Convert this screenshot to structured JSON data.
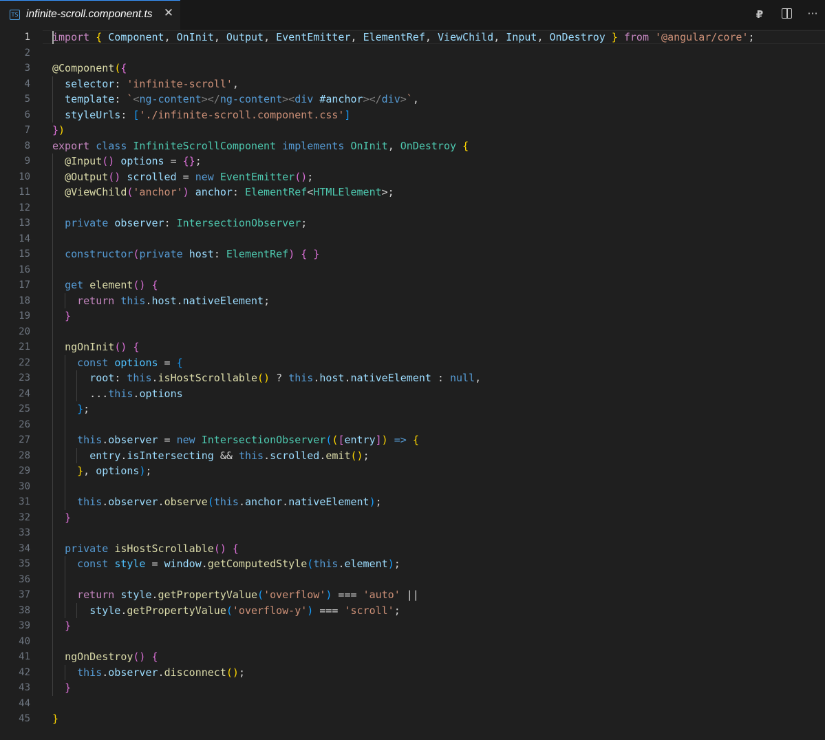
{
  "tab": {
    "icon_text": "TS",
    "filename": "infinite-scroll.component.ts",
    "close_symbol": "✕"
  },
  "toolbar": {
    "preview_icon": "₽",
    "more_icon": "···"
  },
  "editor": {
    "active_line": 1,
    "lines": [
      [
        [
          "k",
          "import"
        ],
        [
          "d",
          " "
        ],
        [
          "y",
          "{"
        ],
        [
          "d",
          " "
        ],
        [
          "v",
          "Component"
        ],
        [
          "d",
          ", "
        ],
        [
          "v",
          "OnInit"
        ],
        [
          "d",
          ", "
        ],
        [
          "v",
          "Output"
        ],
        [
          "d",
          ", "
        ],
        [
          "v",
          "EventEmitter"
        ],
        [
          "d",
          ", "
        ],
        [
          "v",
          "ElementRef"
        ],
        [
          "d",
          ", "
        ],
        [
          "v",
          "ViewChild"
        ],
        [
          "d",
          ", "
        ],
        [
          "v",
          "Input"
        ],
        [
          "d",
          ", "
        ],
        [
          "v",
          "OnDestroy"
        ],
        [
          "d",
          " "
        ],
        [
          "y",
          "}"
        ],
        [
          "d",
          " "
        ],
        [
          "k",
          "from"
        ],
        [
          "d",
          " "
        ],
        [
          "s",
          "'@angular/core'"
        ],
        [
          "d",
          ";"
        ]
      ],
      [],
      [
        [
          "f",
          "@Component"
        ],
        [
          "y",
          "("
        ],
        [
          "p",
          "{"
        ]
      ],
      [
        [
          "d",
          "  "
        ],
        [
          "v",
          "selector"
        ],
        [
          "d",
          ": "
        ],
        [
          "s",
          "'infinite-scroll'"
        ],
        [
          "d",
          ","
        ]
      ],
      [
        [
          "d",
          "  "
        ],
        [
          "v",
          "template"
        ],
        [
          "d",
          ": "
        ],
        [
          "s",
          "`"
        ],
        [
          "tg",
          "<"
        ],
        [
          "b",
          "ng-content"
        ],
        [
          "tg",
          "></"
        ],
        [
          "b",
          "ng-content"
        ],
        [
          "tg",
          "><"
        ],
        [
          "b",
          "div"
        ],
        [
          "d",
          " "
        ],
        [
          "v",
          "#anchor"
        ],
        [
          "tg",
          "></"
        ],
        [
          "b",
          "div"
        ],
        [
          "tg",
          ">"
        ],
        [
          "s",
          "`"
        ],
        [
          "d",
          ","
        ]
      ],
      [
        [
          "d",
          "  "
        ],
        [
          "v",
          "styleUrls"
        ],
        [
          "d",
          ": "
        ],
        [
          "bl",
          "["
        ],
        [
          "s",
          "'./infinite-scroll.component.css'"
        ],
        [
          "bl",
          "]"
        ]
      ],
      [
        [
          "p",
          "}"
        ],
        [
          "y",
          ")"
        ]
      ],
      [
        [
          "k",
          "export"
        ],
        [
          "d",
          " "
        ],
        [
          "b",
          "class"
        ],
        [
          "d",
          " "
        ],
        [
          "t",
          "InfiniteScrollComponent"
        ],
        [
          "d",
          " "
        ],
        [
          "b",
          "implements"
        ],
        [
          "d",
          " "
        ],
        [
          "t",
          "OnInit"
        ],
        [
          "d",
          ", "
        ],
        [
          "t",
          "OnDestroy"
        ],
        [
          "d",
          " "
        ],
        [
          "y",
          "{"
        ]
      ],
      [
        [
          "d",
          "  "
        ],
        [
          "f",
          "@Input"
        ],
        [
          "p",
          "()"
        ],
        [
          "d",
          " "
        ],
        [
          "v",
          "options"
        ],
        [
          "d",
          " = "
        ],
        [
          "p",
          "{}"
        ],
        [
          "d",
          ";"
        ]
      ],
      [
        [
          "d",
          "  "
        ],
        [
          "f",
          "@Output"
        ],
        [
          "p",
          "()"
        ],
        [
          "d",
          " "
        ],
        [
          "v",
          "scrolled"
        ],
        [
          "d",
          " = "
        ],
        [
          "b",
          "new"
        ],
        [
          "d",
          " "
        ],
        [
          "t",
          "EventEmitter"
        ],
        [
          "p",
          "()"
        ],
        [
          "d",
          ";"
        ]
      ],
      [
        [
          "d",
          "  "
        ],
        [
          "f",
          "@ViewChild"
        ],
        [
          "p",
          "("
        ],
        [
          "s",
          "'anchor'"
        ],
        [
          "p",
          ")"
        ],
        [
          "d",
          " "
        ],
        [
          "v",
          "anchor"
        ],
        [
          "d",
          ": "
        ],
        [
          "t",
          "ElementRef"
        ],
        [
          "d",
          "<"
        ],
        [
          "t",
          "HTMLElement"
        ],
        [
          "d",
          ">;"
        ]
      ],
      [],
      [
        [
          "d",
          "  "
        ],
        [
          "b",
          "private"
        ],
        [
          "d",
          " "
        ],
        [
          "v",
          "observer"
        ],
        [
          "d",
          ": "
        ],
        [
          "t",
          "IntersectionObserver"
        ],
        [
          "d",
          ";"
        ]
      ],
      [],
      [
        [
          "d",
          "  "
        ],
        [
          "b",
          "constructor"
        ],
        [
          "p",
          "("
        ],
        [
          "b",
          "private"
        ],
        [
          "d",
          " "
        ],
        [
          "v",
          "host"
        ],
        [
          "d",
          ": "
        ],
        [
          "t",
          "ElementRef"
        ],
        [
          "p",
          ")"
        ],
        [
          "d",
          " "
        ],
        [
          "p",
          "{ }"
        ]
      ],
      [],
      [
        [
          "d",
          "  "
        ],
        [
          "b",
          "get"
        ],
        [
          "d",
          " "
        ],
        [
          "f",
          "element"
        ],
        [
          "p",
          "()"
        ],
        [
          "d",
          " "
        ],
        [
          "p",
          "{"
        ]
      ],
      [
        [
          "d",
          "    "
        ],
        [
          "k",
          "return"
        ],
        [
          "d",
          " "
        ],
        [
          "b",
          "this"
        ],
        [
          "d",
          "."
        ],
        [
          "v",
          "host"
        ],
        [
          "d",
          "."
        ],
        [
          "v",
          "nativeElement"
        ],
        [
          "d",
          ";"
        ]
      ],
      [
        [
          "d",
          "  "
        ],
        [
          "p",
          "}"
        ]
      ],
      [],
      [
        [
          "d",
          "  "
        ],
        [
          "f",
          "ngOnInit"
        ],
        [
          "p",
          "()"
        ],
        [
          "d",
          " "
        ],
        [
          "p",
          "{"
        ]
      ],
      [
        [
          "d",
          "    "
        ],
        [
          "b",
          "const"
        ],
        [
          "d",
          " "
        ],
        [
          "c",
          "options"
        ],
        [
          "d",
          " = "
        ],
        [
          "bl",
          "{"
        ]
      ],
      [
        [
          "d",
          "      "
        ],
        [
          "v",
          "root"
        ],
        [
          "d",
          ": "
        ],
        [
          "b",
          "this"
        ],
        [
          "d",
          "."
        ],
        [
          "f",
          "isHostScrollable"
        ],
        [
          "y",
          "()"
        ],
        [
          "d",
          " ? "
        ],
        [
          "b",
          "this"
        ],
        [
          "d",
          "."
        ],
        [
          "v",
          "host"
        ],
        [
          "d",
          "."
        ],
        [
          "v",
          "nativeElement"
        ],
        [
          "d",
          " : "
        ],
        [
          "b",
          "null"
        ],
        [
          "d",
          ","
        ]
      ],
      [
        [
          "d",
          "      ..."
        ],
        [
          "b",
          "this"
        ],
        [
          "d",
          "."
        ],
        [
          "v",
          "options"
        ]
      ],
      [
        [
          "d",
          "    "
        ],
        [
          "bl",
          "}"
        ],
        [
          "d",
          ";"
        ]
      ],
      [],
      [
        [
          "d",
          "    "
        ],
        [
          "b",
          "this"
        ],
        [
          "d",
          "."
        ],
        [
          "v",
          "observer"
        ],
        [
          "d",
          " = "
        ],
        [
          "b",
          "new"
        ],
        [
          "d",
          " "
        ],
        [
          "t",
          "IntersectionObserver"
        ],
        [
          "bl",
          "("
        ],
        [
          "y",
          "("
        ],
        [
          "p",
          "["
        ],
        [
          "v",
          "entry"
        ],
        [
          "p",
          "]"
        ],
        [
          "y",
          ")"
        ],
        [
          "d",
          " "
        ],
        [
          "b",
          "=>"
        ],
        [
          "d",
          " "
        ],
        [
          "y",
          "{"
        ]
      ],
      [
        [
          "d",
          "      "
        ],
        [
          "v",
          "entry"
        ],
        [
          "d",
          "."
        ],
        [
          "v",
          "isIntersecting"
        ],
        [
          "d",
          " && "
        ],
        [
          "b",
          "this"
        ],
        [
          "d",
          "."
        ],
        [
          "v",
          "scrolled"
        ],
        [
          "d",
          "."
        ],
        [
          "f",
          "emit"
        ],
        [
          "y",
          "()"
        ],
        [
          "d",
          ";"
        ]
      ],
      [
        [
          "d",
          "    "
        ],
        [
          "y",
          "}"
        ],
        [
          "d",
          ", "
        ],
        [
          "v",
          "options"
        ],
        [
          "bl",
          ")"
        ],
        [
          "d",
          ";"
        ]
      ],
      [],
      [
        [
          "d",
          "    "
        ],
        [
          "b",
          "this"
        ],
        [
          "d",
          "."
        ],
        [
          "v",
          "observer"
        ],
        [
          "d",
          "."
        ],
        [
          "f",
          "observe"
        ],
        [
          "bl",
          "("
        ],
        [
          "b",
          "this"
        ],
        [
          "d",
          "."
        ],
        [
          "v",
          "anchor"
        ],
        [
          "d",
          "."
        ],
        [
          "v",
          "nativeElement"
        ],
        [
          "bl",
          ")"
        ],
        [
          "d",
          ";"
        ]
      ],
      [
        [
          "d",
          "  "
        ],
        [
          "p",
          "}"
        ]
      ],
      [],
      [
        [
          "d",
          "  "
        ],
        [
          "b",
          "private"
        ],
        [
          "d",
          " "
        ],
        [
          "f",
          "isHostScrollable"
        ],
        [
          "p",
          "()"
        ],
        [
          "d",
          " "
        ],
        [
          "p",
          "{"
        ]
      ],
      [
        [
          "d",
          "    "
        ],
        [
          "b",
          "const"
        ],
        [
          "d",
          " "
        ],
        [
          "c",
          "style"
        ],
        [
          "d",
          " = "
        ],
        [
          "v",
          "window"
        ],
        [
          "d",
          "."
        ],
        [
          "f",
          "getComputedStyle"
        ],
        [
          "bl",
          "("
        ],
        [
          "b",
          "this"
        ],
        [
          "d",
          "."
        ],
        [
          "v",
          "element"
        ],
        [
          "bl",
          ")"
        ],
        [
          "d",
          ";"
        ]
      ],
      [],
      [
        [
          "d",
          "    "
        ],
        [
          "k",
          "return"
        ],
        [
          "d",
          " "
        ],
        [
          "v",
          "style"
        ],
        [
          "d",
          "."
        ],
        [
          "f",
          "getPropertyValue"
        ],
        [
          "bl",
          "("
        ],
        [
          "s",
          "'overflow'"
        ],
        [
          "bl",
          ")"
        ],
        [
          "d",
          " === "
        ],
        [
          "s",
          "'auto'"
        ],
        [
          "d",
          " ||"
        ]
      ],
      [
        [
          "d",
          "      "
        ],
        [
          "v",
          "style"
        ],
        [
          "d",
          "."
        ],
        [
          "f",
          "getPropertyValue"
        ],
        [
          "bl",
          "("
        ],
        [
          "s",
          "'overflow-y'"
        ],
        [
          "bl",
          ")"
        ],
        [
          "d",
          " === "
        ],
        [
          "s",
          "'scroll'"
        ],
        [
          "d",
          ";"
        ]
      ],
      [
        [
          "d",
          "  "
        ],
        [
          "p",
          "}"
        ]
      ],
      [],
      [
        [
          "d",
          "  "
        ],
        [
          "f",
          "ngOnDestroy"
        ],
        [
          "p",
          "()"
        ],
        [
          "d",
          " "
        ],
        [
          "p",
          "{"
        ]
      ],
      [
        [
          "d",
          "    "
        ],
        [
          "b",
          "this"
        ],
        [
          "d",
          "."
        ],
        [
          "v",
          "observer"
        ],
        [
          "d",
          "."
        ],
        [
          "f",
          "disconnect"
        ],
        [
          "y",
          "()"
        ],
        [
          "d",
          ";"
        ]
      ],
      [
        [
          "d",
          "  "
        ],
        [
          "p",
          "}"
        ]
      ],
      [],
      [
        [
          "y",
          "}"
        ]
      ]
    ]
  },
  "colors": {
    "editor_background": "#1f1f1f",
    "keyword_control": "#c586c0",
    "keyword": "#569cd6",
    "variable": "#9cdcfe",
    "function": "#dcdcaa",
    "type": "#4ec9b0",
    "string": "#ce9178"
  }
}
